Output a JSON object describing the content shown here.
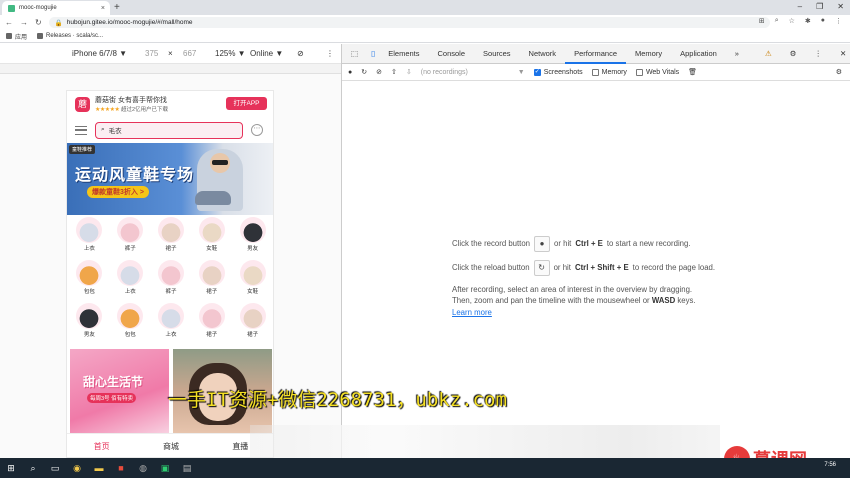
{
  "browser": {
    "tab_title": "mooc-mogujie",
    "tab_close": "×",
    "new_tab": "+",
    "window_controls": [
      "–",
      "❐",
      "✕"
    ],
    "url": "hubojun.gitee.io/mooc-mogujie/#/mall/home",
    "bookmarks": [
      "应用",
      "Releases · scala/sc..."
    ]
  },
  "device_toolbar": {
    "device": "iPhone 6/7/8 ▼",
    "width": "375",
    "times": "×",
    "height": "667",
    "zoom": "125% ▼",
    "network": "Online ▼"
  },
  "mobile": {
    "app_banner": {
      "logo_glyph": "蘑",
      "name": "蘑菇街 女有喜手帮你找",
      "stars": "★★★★★",
      "sub": "超过2亿用户已下载",
      "open_button": "打开APP"
    },
    "search": {
      "value": "毛衣",
      "more": "⋯"
    },
    "hero": {
      "tag": "童鞋推荐",
      "title": "运动风童鞋专场",
      "sub": "爆款童鞋3折入 >"
    },
    "categories": [
      {
        "label": "上衣",
        "color": "#d6dce8"
      },
      {
        "label": "裤子",
        "color": "#f3c6cf"
      },
      {
        "label": "裙子",
        "color": "#e8d2c4"
      },
      {
        "label": "女鞋",
        "color": "#ead9c5"
      },
      {
        "label": "男友",
        "color": "#2f3238"
      },
      {
        "label": "包包",
        "color": "#f0a64a"
      },
      {
        "label": "上衣",
        "color": "#d6dce8"
      },
      {
        "label": "裤子",
        "color": "#f3c6cf"
      },
      {
        "label": "裙子",
        "color": "#e8d2c4"
      },
      {
        "label": "女鞋",
        "color": "#ead9c5"
      },
      {
        "label": "男友",
        "color": "#2f3238"
      },
      {
        "label": "包包",
        "color": "#f0a64a"
      },
      {
        "label": "上衣",
        "color": "#d6dce8"
      },
      {
        "label": "裙子",
        "color": "#f3c6cf"
      },
      {
        "label": "裙子",
        "color": "#e8d2c4"
      }
    ],
    "promo": {
      "title": "甜心生活节",
      "sub": "每周3号 佰有特卖"
    },
    "tabbar": [
      "首页",
      "商城",
      "直播"
    ]
  },
  "devtools": {
    "tabs": [
      "Elements",
      "Console",
      "Sources",
      "Network",
      "Performance",
      "Memory",
      "Application",
      "»"
    ],
    "active_tab": "Performance",
    "warnings": "⚠ 1",
    "recordings_placeholder": "(no recordings)",
    "checkboxes": [
      {
        "label": "Screenshots",
        "checked": true
      },
      {
        "label": "Memory",
        "checked": false
      },
      {
        "label": "Web Vitals",
        "checked": false
      }
    ],
    "landing": {
      "line1_pre": "Click the record button",
      "line1_mid": "or hit",
      "line1_key": "Ctrl + E",
      "line1_post": "to start a new recording.",
      "line2_pre": "Click the reload button",
      "line2_mid": "or hit",
      "line2_key": "Ctrl + Shift + E",
      "line2_post": "to record the page load.",
      "para1": "After recording, select an area of interest in the overview by dragging.",
      "para2_pre": "Then, zoom and pan the timeline with the mousewheel or",
      "para2_key": "WASD",
      "para2_post": "keys.",
      "learn_more": "Learn more"
    }
  },
  "overlay": {
    "watermark": "一手IT资源+微信2268731，ubkz.com",
    "logo_text": "慕课网",
    "logo_glyph": "♨"
  },
  "taskbar": {
    "clock": "7:56"
  },
  "colors": {
    "accent": "#e6325a",
    "devtools_blue": "#1a73e8"
  }
}
